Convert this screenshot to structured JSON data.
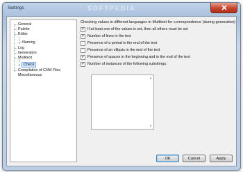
{
  "window": {
    "title": "Settings",
    "watermark": "SOFTPEDIA"
  },
  "tree": {
    "items": [
      {
        "label": "General"
      },
      {
        "label": "Palette"
      },
      {
        "label": "Editor"
      },
      {
        "label": "Naming"
      },
      {
        "label": "Log"
      },
      {
        "label": "Generation"
      },
      {
        "label": "Multitext"
      },
      {
        "label": "Check",
        "selected": true
      },
      {
        "label": "Compilation of CHM Files"
      },
      {
        "label": "Miscellaneous"
      }
    ]
  },
  "main": {
    "title": "Checking values in different languages in Multitext for correspondence (during generation)",
    "checks": [
      {
        "label": "If at least one of the values is set, then all others must be set",
        "checked": true
      },
      {
        "label": "Number of lines in the text",
        "checked": true
      },
      {
        "label": "Presence of a period in the end of the text",
        "checked": false
      },
      {
        "label": "Presence of an ellipsis in the end of the text",
        "checked": false
      },
      {
        "label": "Presence of spaces in the beginning and in the end of the text",
        "checked": true
      },
      {
        "label": "Number of instances of the following substrings:",
        "checked": true
      }
    ]
  },
  "buttons": {
    "ok": "OK",
    "cancel": "Cancel",
    "apply": "Apply"
  },
  "colors": {
    "selection": "#cde4fb",
    "close_button": "#c4452c",
    "check_mark": "#1c3d7c"
  }
}
